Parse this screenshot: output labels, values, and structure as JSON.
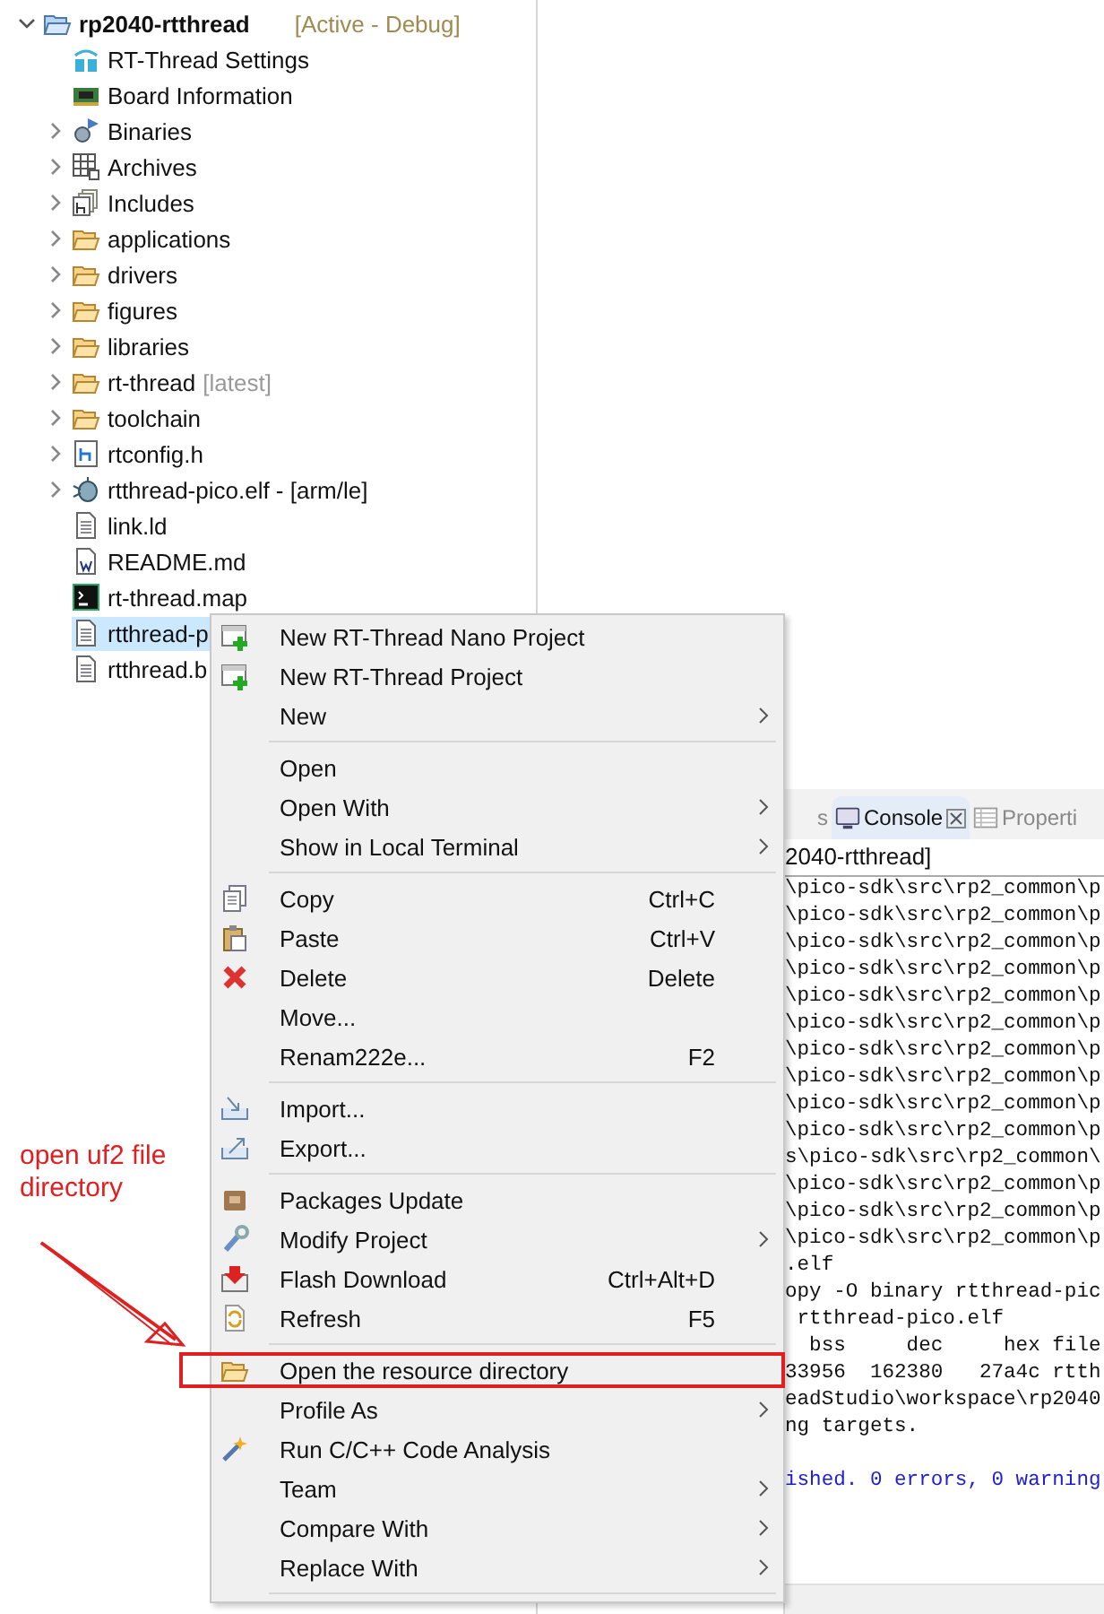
{
  "project_tree": {
    "label": "rp2040-rtthread",
    "decoration": "[Active - Debug]",
    "expanded": true,
    "children": [
      {
        "label": "RT-Thread Settings",
        "kind": "rt-logo",
        "expandable": false,
        "selected": false
      },
      {
        "label": "Board Information",
        "kind": "board",
        "expandable": false,
        "selected": false
      },
      {
        "label": "Binaries",
        "kind": "binaries",
        "expandable": true,
        "selected": false
      },
      {
        "label": "Archives",
        "kind": "archives",
        "expandable": true,
        "selected": false
      },
      {
        "label": "Includes",
        "kind": "includes",
        "expandable": true,
        "selected": false
      },
      {
        "label": "applications",
        "kind": "folder",
        "expandable": true,
        "selected": false
      },
      {
        "label": "drivers",
        "kind": "folder",
        "expandable": true,
        "selected": false
      },
      {
        "label": "figures",
        "kind": "folder",
        "expandable": true,
        "selected": false
      },
      {
        "label": "libraries",
        "kind": "folder",
        "expandable": true,
        "selected": false
      },
      {
        "label": "rt-thread",
        "decoration": "[latest]",
        "kind": "folder",
        "expandable": true,
        "selected": false
      },
      {
        "label": "toolchain",
        "kind": "folder",
        "expandable": true,
        "selected": false
      },
      {
        "label": "rtconfig.h",
        "kind": "header",
        "expandable": true,
        "selected": false
      },
      {
        "label": "rtthread-pico.elf - [arm/le]",
        "kind": "bug",
        "expandable": true,
        "selected": false
      },
      {
        "label": "link.ld",
        "kind": "text",
        "expandable": false,
        "selected": false
      },
      {
        "label": "README.md",
        "kind": "word",
        "expandable": false,
        "selected": false
      },
      {
        "label": "rt-thread.map",
        "kind": "terminal",
        "expandable": false,
        "selected": false
      },
      {
        "label": "rtthread-p",
        "kind": "text",
        "expandable": false,
        "selected": true
      },
      {
        "label": "rtthread.b",
        "kind": "text",
        "expandable": false,
        "selected": false
      }
    ]
  },
  "console": {
    "tabs": [
      {
        "label": "s",
        "selected": false,
        "closable": false,
        "kind": "plain"
      },
      {
        "label": "Console",
        "selected": true,
        "closable": true,
        "kind": "monitor"
      },
      {
        "label": "Properti",
        "selected": false,
        "closable": false,
        "kind": "table"
      }
    ],
    "header": "2040-rtthread]",
    "lines": [
      {
        "text": "\\pico-sdk\\src\\rp2_common\\p",
        "kind": "normal"
      },
      {
        "text": "\\pico-sdk\\src\\rp2_common\\p",
        "kind": "normal"
      },
      {
        "text": "\\pico-sdk\\src\\rp2_common\\p",
        "kind": "normal"
      },
      {
        "text": "\\pico-sdk\\src\\rp2_common\\p",
        "kind": "normal"
      },
      {
        "text": "\\pico-sdk\\src\\rp2_common\\p",
        "kind": "normal"
      },
      {
        "text": "\\pico-sdk\\src\\rp2_common\\p",
        "kind": "normal"
      },
      {
        "text": "\\pico-sdk\\src\\rp2_common\\p",
        "kind": "normal"
      },
      {
        "text": "\\pico-sdk\\src\\rp2_common\\p",
        "kind": "normal"
      },
      {
        "text": "\\pico-sdk\\src\\rp2_common\\p",
        "kind": "normal"
      },
      {
        "text": "\\pico-sdk\\src\\rp2_common\\p",
        "kind": "normal"
      },
      {
        "text": "s\\pico-sdk\\src\\rp2_common\\",
        "kind": "normal"
      },
      {
        "text": "\\pico-sdk\\src\\rp2_common\\p",
        "kind": "normal"
      },
      {
        "text": "\\pico-sdk\\src\\rp2_common\\p",
        "kind": "normal"
      },
      {
        "text": "\\pico-sdk\\src\\rp2_common\\p",
        "kind": "normal"
      },
      {
        "text": ".elf",
        "kind": "normal"
      },
      {
        "text": "opy -O binary rtthread-pic",
        "kind": "normal"
      },
      {
        "text": " rtthread-pico.elf",
        "kind": "normal"
      },
      {
        "text": "  bss     dec     hex file",
        "kind": "normal"
      },
      {
        "text": "33956  162380   27a4c rtth",
        "kind": "normal"
      },
      {
        "text": "eadStudio\\workspace\\rp2040",
        "kind": "normal"
      },
      {
        "text": "ng targets.",
        "kind": "normal"
      },
      {
        "kind": "blank"
      },
      {
        "text": "ished. 0 errors, 0 warning",
        "kind": "info"
      }
    ]
  },
  "context_menu": [
    {
      "kind": "new-project",
      "label": "New RT-Thread Nano Project",
      "submenu": false
    },
    {
      "kind": "new-project",
      "label": "New RT-Thread Project",
      "submenu": false
    },
    {
      "kind": "plain",
      "label": "New",
      "submenu": true
    },
    {
      "kind": "separator"
    },
    {
      "kind": "plain",
      "label": "Open",
      "submenu": false
    },
    {
      "kind": "plain",
      "label": "Open With",
      "submenu": true
    },
    {
      "kind": "plain",
      "label": "Show in Local Terminal",
      "submenu": true
    },
    {
      "kind": "separator"
    },
    {
      "kind": "copy",
      "label": "Copy",
      "shortcut": "Ctrl+C",
      "submenu": false
    },
    {
      "kind": "paste",
      "label": "Paste",
      "shortcut": "Ctrl+V",
      "submenu": false
    },
    {
      "kind": "delete",
      "label": "Delete",
      "shortcut": "Delete",
      "submenu": false
    },
    {
      "kind": "plain",
      "label": "Move...",
      "submenu": false
    },
    {
      "kind": "plain",
      "label": "Renam222e...",
      "shortcut": "F2",
      "submenu": false
    },
    {
      "kind": "separator"
    },
    {
      "kind": "import",
      "label": "Import...",
      "submenu": false
    },
    {
      "kind": "export",
      "label": "Export...",
      "submenu": false
    },
    {
      "kind": "separator"
    },
    {
      "kind": "package",
      "label": "Packages Update",
      "submenu": false
    },
    {
      "kind": "wrench",
      "label": "Modify Project",
      "submenu": true
    },
    {
      "kind": "flash",
      "label": "Flash Download",
      "shortcut": "Ctrl+Alt+D",
      "submenu": false
    },
    {
      "kind": "refresh",
      "label": "Refresh",
      "shortcut": "F5",
      "submenu": false
    },
    {
      "kind": "separator"
    },
    {
      "kind": "folder",
      "label": "Open the resource directory",
      "submenu": false
    },
    {
      "kind": "plain",
      "label": "Profile As",
      "submenu": true
    },
    {
      "kind": "analysis",
      "label": "Run C/C++ Code Analysis",
      "submenu": false
    },
    {
      "kind": "plain",
      "label": "Team",
      "submenu": true
    },
    {
      "kind": "plain",
      "label": "Compare With",
      "submenu": true
    },
    {
      "kind": "plain",
      "label": "Replace With",
      "submenu": true
    },
    {
      "kind": "separator"
    }
  ],
  "annotation": {
    "text": "open uf2 file directory"
  }
}
